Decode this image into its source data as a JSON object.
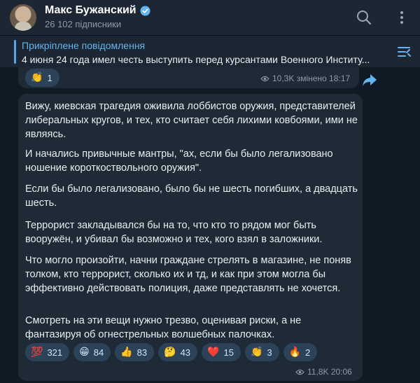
{
  "channel": {
    "name": "Макс Бужанский",
    "subscribers": "26 102 підписники"
  },
  "pinned": {
    "label": "Прикріплене повідомлення",
    "text": "4 июня 24 года имел честь выступить перед курсантами Военного Институ..."
  },
  "prev_message": {
    "reaction": {
      "emoji": "👏",
      "count": "1"
    },
    "views": "10,3K",
    "edited_time": "змінено 18:17"
  },
  "message": {
    "paragraphs": [
      "Вижу, киевская трагедия оживила лоббистов оружия, представителей либеральных кругов, и тех, кто считает себя лихими ковбоями, ими не являясь.",
      "И начались привычные мантры, \"ах, если бы было легализовано ношение короткоствольного оружия\".",
      "Если бы было легализовано, было бы не шесть погибших, а двадцать шесть.",
      "Террорист закладывался бы на то, что кто то рядом мог быть вооружён, и убивал бы возможно и тех, кого взял в заложники.",
      "Что могло произойти, начни граждане стрелять в магазине, не поняв толком, кто террорист, сколько их и тд, и как при этом могла бы эффективно действовать полиция, даже представлять не хочется.",
      "Смотреть на эти вещи нужно трезво, оценивая риски, а не фантазируя об огнестрельных волшебных палочках."
    ],
    "reactions": [
      {
        "emoji": "💯",
        "count": "321"
      },
      {
        "emoji": "😁",
        "count": "84"
      },
      {
        "emoji": "👍",
        "count": "83"
      },
      {
        "emoji": "🤔",
        "count": "43"
      },
      {
        "emoji": "❤️",
        "count": "15"
      },
      {
        "emoji": "👏",
        "count": "3"
      },
      {
        "emoji": "🔥",
        "count": "2"
      }
    ],
    "views": "11,8K",
    "time": "20:06"
  },
  "colors": {
    "background": "#0f1a24",
    "header": "#1d2733",
    "bubble": "#1e2a35",
    "accent": "#64b5ef",
    "reaction_bg": "#2b4258"
  },
  "icons": {
    "verified": "verified-badge-icon",
    "search": "search-icon",
    "more": "more-vertical-icon",
    "pinned_list": "pinned-list-icon",
    "views": "eye-icon",
    "share": "share-arrow-icon"
  }
}
